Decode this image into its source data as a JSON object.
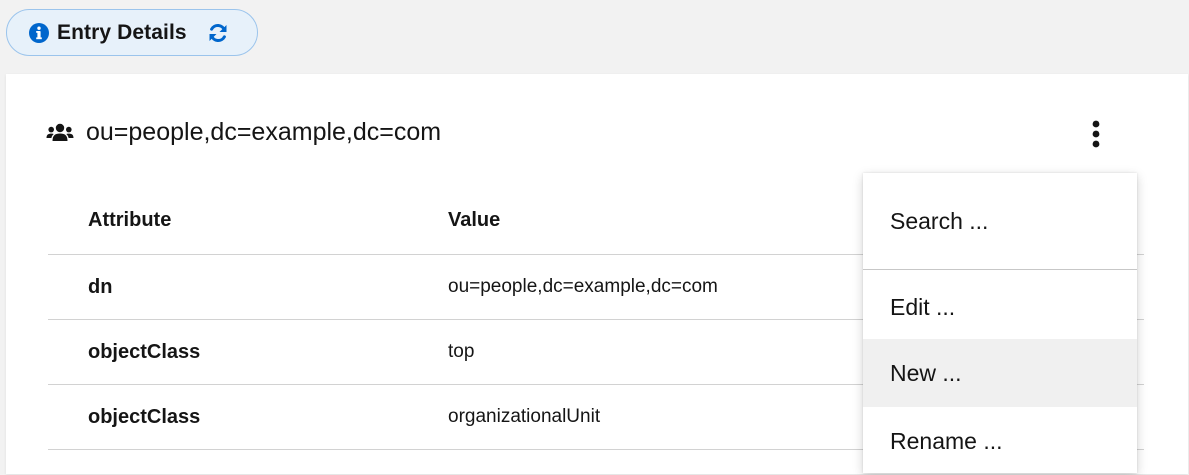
{
  "tab": {
    "label": "Entry Details",
    "info_icon": "info-circle-icon",
    "refresh_icon": "refresh-icon",
    "accent_color": "#0066cc"
  },
  "entry": {
    "icon": "users-icon",
    "title": "ou=people,dc=example,dc=com"
  },
  "table": {
    "headers": [
      "Attribute",
      "Value"
    ],
    "rows": [
      {
        "attribute": "dn",
        "value": "ou=people,dc=example,dc=com"
      },
      {
        "attribute": "objectClass",
        "value": "top"
      },
      {
        "attribute": "objectClass",
        "value": "organizationalUnit"
      }
    ]
  },
  "menu": {
    "items": [
      "Search ...",
      "Edit ...",
      "New ...",
      "Rename ..."
    ],
    "highlighted": "New ..."
  }
}
